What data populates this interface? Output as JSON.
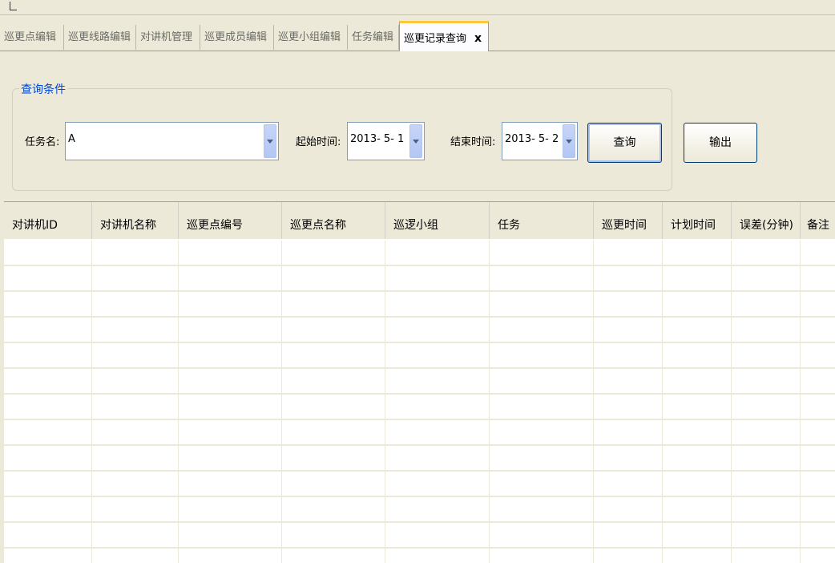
{
  "tabs": [
    {
      "label": "巡更点编辑",
      "active": false
    },
    {
      "label": "巡更线路编辑",
      "active": false
    },
    {
      "label": "对讲机管理",
      "active": false
    },
    {
      "label": "巡更成员编辑",
      "active": false
    },
    {
      "label": "巡更小组编辑",
      "active": false
    },
    {
      "label": "任务编辑",
      "active": false
    },
    {
      "label": "巡更记录查询",
      "active": true,
      "close": "x"
    }
  ],
  "query": {
    "group_title": "查询条件",
    "task_label": "任务名:",
    "task_value": "A",
    "start_label": "起始时间:",
    "start_value": "2013- 5- 1",
    "end_label": "结束时间:",
    "end_value": "2013- 5- 2",
    "query_button": "查询",
    "export_button": "输出"
  },
  "grid": {
    "columns": [
      "对讲机ID",
      "对讲机名称",
      "巡更点编号",
      "巡更点名称",
      "巡逻小组",
      "任务",
      "巡更时间",
      "计划时间",
      "误差(分钟)",
      "备注"
    ],
    "row_count": 12
  }
}
